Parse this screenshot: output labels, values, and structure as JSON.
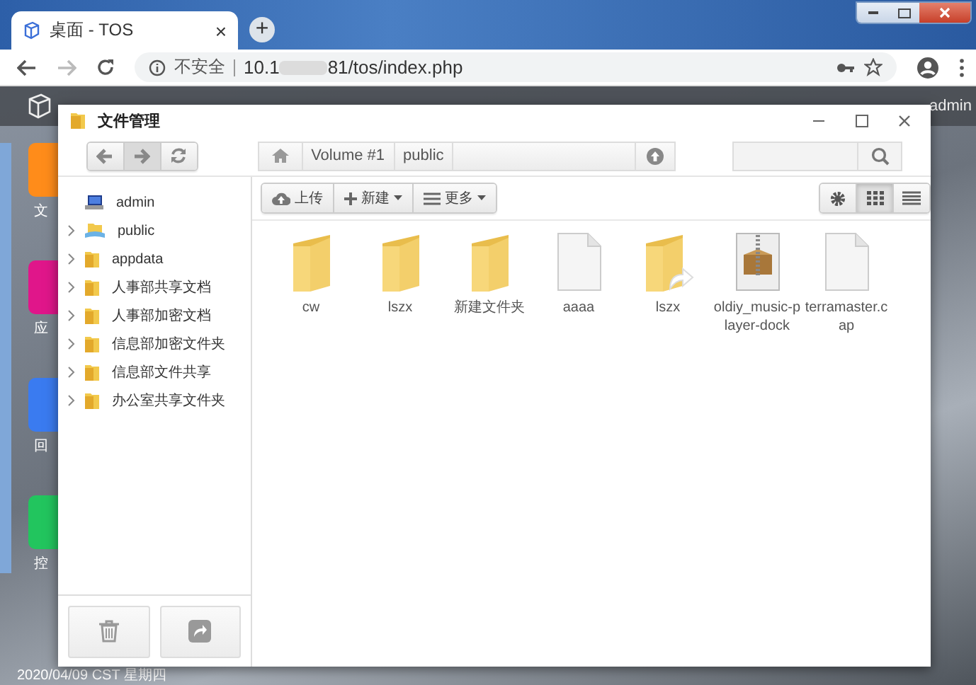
{
  "browser": {
    "tab": {
      "title": "桌面 - TOS",
      "close": "×"
    },
    "new_tab": "+",
    "address": {
      "security": "不安全",
      "url_start": "10.1",
      "url_end": "81/tos/index.php"
    }
  },
  "desktop": {
    "user": "admin",
    "date": "2020/04/09 CST 星期四",
    "dock": [
      {
        "label": "文",
        "color": "#ff8c1a"
      },
      {
        "label": "应",
        "color": "#e0168a"
      },
      {
        "label": "回",
        "color": "#3a7bf0"
      },
      {
        "label": "控",
        "color": "#22c55e"
      }
    ]
  },
  "window": {
    "title": "文件管理",
    "breadcrumb": [
      "Volume #1",
      "public"
    ],
    "tree": [
      {
        "label": "admin",
        "kind": "user",
        "expandable": false
      },
      {
        "label": "public",
        "kind": "share",
        "expandable": true
      },
      {
        "label": "appdata",
        "kind": "folder",
        "expandable": true
      },
      {
        "label": "人事部共享文档",
        "kind": "folder",
        "expandable": true
      },
      {
        "label": "人事部加密文档",
        "kind": "folder",
        "expandable": true
      },
      {
        "label": "信息部加密文件夹",
        "kind": "folder",
        "expandable": true
      },
      {
        "label": "信息部文件共享",
        "kind": "folder",
        "expandable": true
      },
      {
        "label": "办公室共享文件夹",
        "kind": "folder",
        "expandable": true
      }
    ],
    "toolbar": [
      {
        "label": "上传",
        "kind": "upload",
        "dropdown": false
      },
      {
        "label": "新建",
        "kind": "new",
        "dropdown": true
      },
      {
        "label": "更多",
        "kind": "more",
        "dropdown": true
      }
    ],
    "views": [
      {
        "kind": "settings",
        "selected": false
      },
      {
        "kind": "grid",
        "selected": true
      },
      {
        "kind": "list",
        "selected": false
      }
    ],
    "files": [
      {
        "name": "cw",
        "kind": "folder"
      },
      {
        "name": "lszx",
        "kind": "folder"
      },
      {
        "name": "新建文件夹",
        "kind": "folder"
      },
      {
        "name": "aaaa",
        "kind": "file"
      },
      {
        "name": "lszx",
        "kind": "folder-link"
      },
      {
        "name": "oldiy_music-player-dock",
        "kind": "archive"
      },
      {
        "name": "terramaster.cap",
        "kind": "file"
      }
    ]
  }
}
